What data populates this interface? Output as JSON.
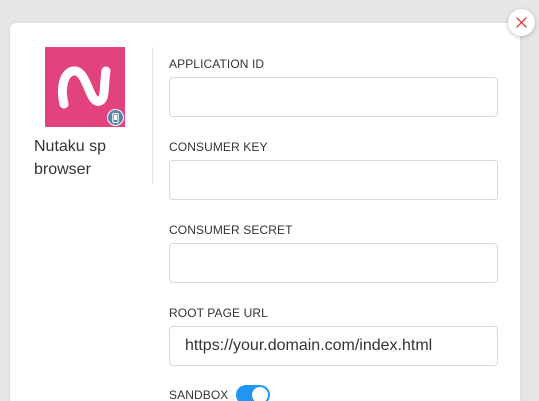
{
  "app": {
    "name": "Nutaku sp browser",
    "logo_color": "#e2427e",
    "logo_icon": "nutaku-n-logo-icon",
    "platform_icon": "mobile-phone-icon"
  },
  "close_icon": "close-icon",
  "form": {
    "fields": [
      {
        "label": "APPLICATION ID",
        "value": "",
        "placeholder": ""
      },
      {
        "label": "CONSUMER KEY",
        "value": "",
        "placeholder": ""
      },
      {
        "label": "CONSUMER SECRET",
        "value": "",
        "placeholder": ""
      },
      {
        "label": "ROOT PAGE URL",
        "value": "https://your.domain.com/index.html",
        "placeholder": ""
      }
    ],
    "sandbox": {
      "label": "SANDBOX",
      "enabled": true,
      "color": "#2196f3"
    }
  },
  "colors": {
    "close_x": "#e0413f",
    "background": "#e6e6e6"
  }
}
